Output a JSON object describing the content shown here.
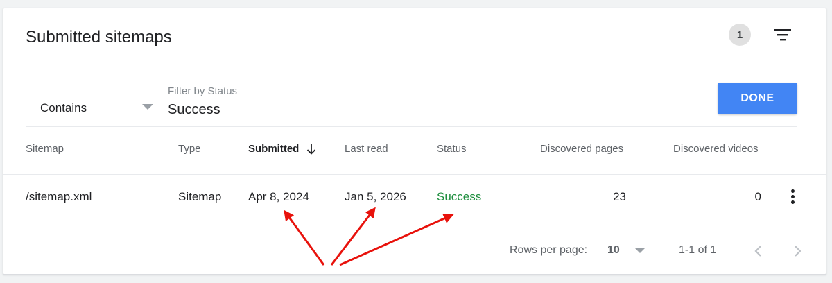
{
  "header": {
    "title": "Submitted sitemaps",
    "filter_count": "1",
    "filter_icon": "filter-list-icon"
  },
  "filter": {
    "operator": "Contains",
    "label": "Filter by Status",
    "value": "Success",
    "done_label": "DONE"
  },
  "table": {
    "columns": [
      "Sitemap",
      "Type",
      "Submitted",
      "Last read",
      "Status",
      "Discovered pages",
      "Discovered videos"
    ],
    "sorted_column": "Submitted",
    "sort_direction": "descending",
    "rows": [
      {
        "sitemap": "/sitemap.xml",
        "type": "Sitemap",
        "submitted": "Apr 8, 2024",
        "last_read": "Jan 5, 2026",
        "status": "Success",
        "discovered_pages": "23",
        "discovered_videos": "0"
      }
    ]
  },
  "pagination": {
    "rows_per_page_label": "Rows per page:",
    "rows_per_page": "10",
    "range": "1-1 of 1"
  },
  "colors": {
    "primary": "#4285f4",
    "success": "#1e8e3e",
    "annotation_arrow": "#e8120c"
  }
}
